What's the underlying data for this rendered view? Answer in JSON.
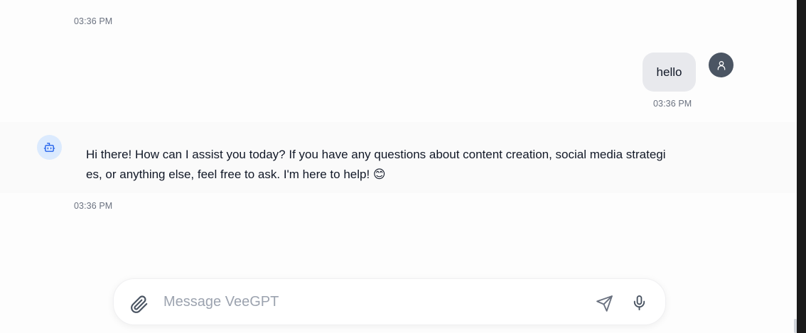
{
  "messages": [
    {
      "role": "meta",
      "timestamp": "03:36 PM"
    },
    {
      "role": "user",
      "text": "hello",
      "timestamp": "03:36 PM"
    },
    {
      "role": "assistant",
      "text": "Hi there! How can I assist you today? If you have any questions about content creation, social media strategies, or anything else, feel free to ask. I'm here to help! 😊",
      "timestamp": "03:36 PM"
    }
  ],
  "composer": {
    "placeholder": "Message VeeGPT",
    "value": ""
  },
  "icons": {
    "user_avatar": "person-icon",
    "bot_avatar": "robot-icon",
    "attach": "paperclip-icon",
    "send": "send-icon",
    "mic": "microphone-icon"
  },
  "colors": {
    "user_bubble": "#e8e9ed",
    "user_avatar_bg": "#4b5563",
    "bot_avatar_bg": "#dbeafe",
    "bot_icon": "#2563eb"
  }
}
